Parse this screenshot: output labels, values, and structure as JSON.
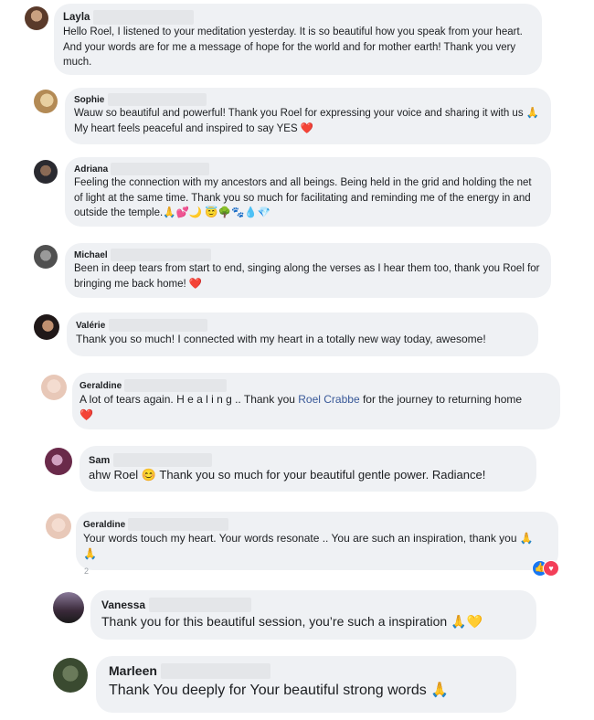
{
  "comments": [
    {
      "name": "Layla",
      "text": "Hello Roel, I listened to your meditation yesterday. It is so beautiful how you speak from your heart. And your words are for me a message of hope for the world and for mother earth! Thank you very much."
    },
    {
      "name": "Sophie",
      "text": "Wauw so beautiful and powerful! Thank you Roel for expressing your voice and sharing it with us 🙏 My heart feels peaceful and inspired to say YES ❤️"
    },
    {
      "name": "Adriana",
      "text": "Feeling the connection with my ancestors and all beings. Being held in the grid and holding the net of light at the same time. Thank you so much for facilitating and reminding me of the energy in and outside the temple.🙏💕🌙 😇🌳🐾💧💎"
    },
    {
      "name": "Michael",
      "text": "Been in deep tears from start to end, singing along the verses as I hear them too, thank you Roel for bringing me back home! ❤️"
    },
    {
      "name": "Valérie",
      "text": "Thank you so much! I connected with my heart in a totally new way today, awesome!"
    },
    {
      "name": "Geraldine",
      "text_a": "A lot of tears again. H e a l i n g .. Thank you ",
      "link": "Roel Crabbe",
      "text_b": " for the journey to returning home",
      "text_c": "❤️"
    },
    {
      "name": "Sam",
      "text": "ahw Roel 😊 Thank you so much for your beautiful gentle power. Radiance!"
    },
    {
      "name": "Geraldine",
      "text": "Your words touch my heart. Your words resonate .. You are such an inspiration, thank you 🙏",
      "text2": "🙏",
      "count": "2"
    },
    {
      "name": "Vanessa",
      "text": "Thank you for this beautiful session, you’re such a inspiration 🙏💛"
    },
    {
      "name": "Marleen",
      "text": "Thank You deeply for Your beautiful strong words 🙏"
    }
  ]
}
